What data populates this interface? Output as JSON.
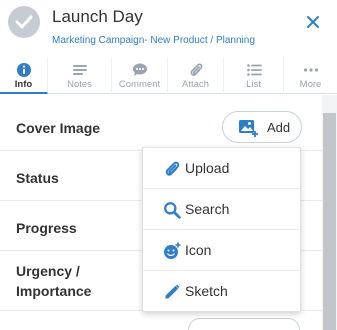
{
  "header": {
    "title": "Launch Day",
    "breadcrumb": "Marketing Campaign- New Product / Planning"
  },
  "tabs": [
    {
      "label": "Info",
      "icon": "info-icon"
    },
    {
      "label": "Notes",
      "icon": "notes-icon"
    },
    {
      "label": "Comment",
      "icon": "comment-icon"
    },
    {
      "label": "Attach",
      "icon": "paperclip-icon"
    },
    {
      "label": "List",
      "icon": "list-icon"
    },
    {
      "label": "More",
      "icon": "more-icon"
    }
  ],
  "fields": {
    "cover_image": "Cover Image",
    "status": "Status",
    "progress": "Progress",
    "urgency_line1": "Urgency /",
    "urgency_line2": "Importance"
  },
  "add_button": {
    "label": "Add"
  },
  "menu": [
    {
      "label": "Upload",
      "icon": "paperclip-icon"
    },
    {
      "label": "Search",
      "icon": "search-icon"
    },
    {
      "label": "Icon",
      "icon": "emoji-add-icon"
    },
    {
      "label": "Sketch",
      "icon": "pencil-icon"
    }
  ],
  "colors": {
    "accent": "#2f7ec9",
    "check_circle": "#c6ccd3",
    "muted": "#9aa5b1"
  }
}
